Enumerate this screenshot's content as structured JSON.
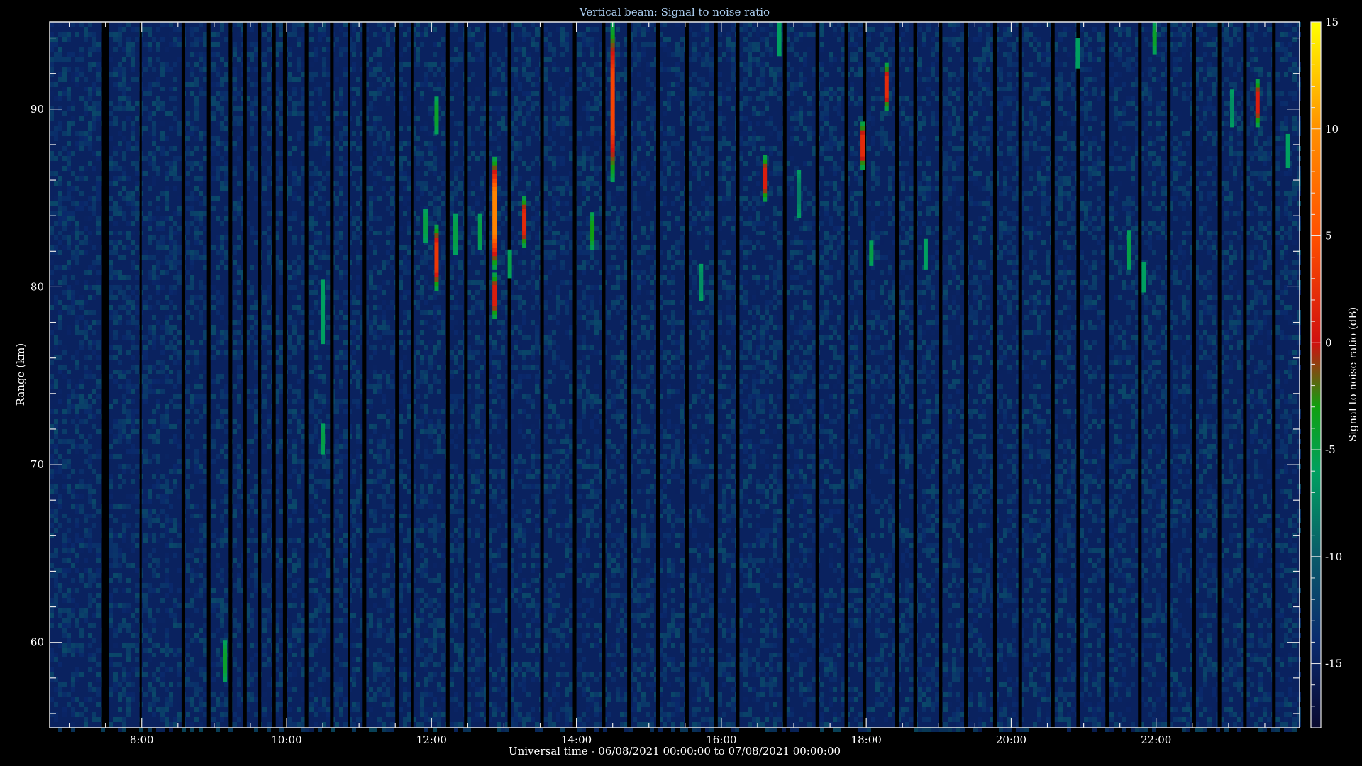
{
  "chart_data": {
    "type": "heatmap",
    "title": "Vertical beam: Signal to noise ratio",
    "xlabel": "Universal time - 06/08/2021 00:00:00 to 07/08/2021 00:00:00",
    "ylabel": "Range (km)",
    "colorbar_label": "Signal to noise ratio (dB)",
    "x_unit": "hours UT",
    "xlim": [
      6.73,
      23.98
    ],
    "ylim": [
      55.2,
      94.9
    ],
    "clim": [
      -18.0,
      15.0
    ],
    "x_ticks": [
      {
        "value": 8,
        "label": "8:00"
      },
      {
        "value": 10,
        "label": "10:00"
      },
      {
        "value": 12,
        "label": "12:00"
      },
      {
        "value": 14,
        "label": "14:00"
      },
      {
        "value": 16,
        "label": "16:00"
      },
      {
        "value": 18,
        "label": "18:00"
      },
      {
        "value": 20,
        "label": "20:00"
      },
      {
        "value": 22,
        "label": "22:00"
      }
    ],
    "y_ticks": [
      {
        "value": 60,
        "label": "60"
      },
      {
        "value": 70,
        "label": "70"
      },
      {
        "value": 80,
        "label": "80"
      },
      {
        "value": 90,
        "label": "90"
      }
    ],
    "colorbar_ticks": [
      {
        "value": 15,
        "label": "15"
      },
      {
        "value": 10,
        "label": "10"
      },
      {
        "value": 5,
        "label": "5"
      },
      {
        "value": 0,
        "label": "0"
      },
      {
        "value": -5,
        "label": "-5"
      },
      {
        "value": -10,
        "label": "-10"
      },
      {
        "value": -15,
        "label": "-15"
      }
    ],
    "colormap": [
      {
        "v": -18,
        "c": "#0a0a30"
      },
      {
        "v": -14,
        "c": "#0a2a6e"
      },
      {
        "v": -10,
        "c": "#0a5a6a"
      },
      {
        "v": -6,
        "c": "#00a060"
      },
      {
        "v": -3,
        "c": "#10a010"
      },
      {
        "v": 0,
        "c": "#d01010"
      },
      {
        "v": 5,
        "c": "#ff5000"
      },
      {
        "v": 10,
        "c": "#ff9000"
      },
      {
        "v": 15,
        "c": "#ffff00"
      }
    ],
    "background_level": -15,
    "data_gaps": [
      {
        "start": 7.45,
        "end": 7.55
      },
      {
        "start": 7.97,
        "end": 8.0
      },
      {
        "start": 8.55,
        "end": 8.6
      },
      {
        "start": 8.9,
        "end": 8.95
      },
      {
        "start": 9.2,
        "end": 9.25
      },
      {
        "start": 9.4,
        "end": 9.45
      },
      {
        "start": 9.6,
        "end": 9.65
      },
      {
        "start": 9.8,
        "end": 9.85
      },
      {
        "start": 9.95,
        "end": 10.0
      },
      {
        "start": 10.25,
        "end": 10.3
      },
      {
        "start": 10.6,
        "end": 10.65
      },
      {
        "start": 10.85,
        "end": 10.88
      },
      {
        "start": 11.05,
        "end": 11.1
      },
      {
        "start": 11.5,
        "end": 11.55
      },
      {
        "start": 11.72,
        "end": 11.75
      },
      {
        "start": 12.2,
        "end": 12.25
      },
      {
        "start": 12.45,
        "end": 12.5
      },
      {
        "start": 12.75,
        "end": 12.8
      },
      {
        "start": 13.05,
        "end": 13.1
      },
      {
        "start": 13.5,
        "end": 13.55
      },
      {
        "start": 13.95,
        "end": 14.0
      },
      {
        "start": 14.35,
        "end": 14.4
      },
      {
        "start": 14.7,
        "end": 14.75
      },
      {
        "start": 15.1,
        "end": 15.15
      },
      {
        "start": 15.5,
        "end": 15.55
      },
      {
        "start": 15.9,
        "end": 15.95
      },
      {
        "start": 16.2,
        "end": 16.25
      },
      {
        "start": 16.85,
        "end": 16.9
      },
      {
        "start": 17.3,
        "end": 17.35
      },
      {
        "start": 17.7,
        "end": 17.75
      },
      {
        "start": 17.95,
        "end": 18.0
      },
      {
        "start": 18.4,
        "end": 18.45
      },
      {
        "start": 18.65,
        "end": 18.7
      },
      {
        "start": 19.0,
        "end": 19.05
      },
      {
        "start": 19.35,
        "end": 19.4
      },
      {
        "start": 19.75,
        "end": 19.8
      },
      {
        "start": 20.1,
        "end": 20.15
      },
      {
        "start": 20.55,
        "end": 20.6
      },
      {
        "start": 20.9,
        "end": 20.95
      },
      {
        "start": 21.3,
        "end": 21.35
      },
      {
        "start": 21.75,
        "end": 21.8
      },
      {
        "start": 22.15,
        "end": 22.2
      },
      {
        "start": 22.5,
        "end": 22.55
      },
      {
        "start": 22.85,
        "end": 22.9
      },
      {
        "start": 23.2,
        "end": 23.25
      },
      {
        "start": 23.6,
        "end": 23.65
      }
    ],
    "echoes": [
      {
        "t": 9.15,
        "r0": 57.8,
        "r1": 60.1,
        "snr": -4
      },
      {
        "t": 10.5,
        "r0": 76.8,
        "r1": 80.4,
        "snr": -6
      },
      {
        "t": 10.5,
        "r0": 70.6,
        "r1": 72.3,
        "snr": -5
      },
      {
        "t": 11.92,
        "r0": 82.5,
        "r1": 84.4,
        "snr": -5
      },
      {
        "t": 12.07,
        "r0": 79.8,
        "r1": 83.5,
        "snr": 3
      },
      {
        "t": 12.07,
        "r0": 88.6,
        "r1": 90.7,
        "snr": -4
      },
      {
        "t": 12.33,
        "r0": 81.8,
        "r1": 84.1,
        "snr": -5
      },
      {
        "t": 12.67,
        "r0": 82.1,
        "r1": 84.1,
        "snr": -5
      },
      {
        "t": 12.87,
        "r0": 81.0,
        "r1": 87.3,
        "snr": 9
      },
      {
        "t": 12.87,
        "r0": 78.2,
        "r1": 80.8,
        "snr": 1
      },
      {
        "t": 13.08,
        "r0": 80.5,
        "r1": 82.1,
        "snr": -5
      },
      {
        "t": 13.28,
        "r0": 82.2,
        "r1": 85.1,
        "snr": 2
      },
      {
        "t": 14.22,
        "r0": 82.1,
        "r1": 84.2,
        "snr": -3
      },
      {
        "t": 14.5,
        "r0": 85.9,
        "r1": 94.9,
        "snr": 4
      },
      {
        "t": 15.72,
        "r0": 79.2,
        "r1": 81.3,
        "snr": -7
      },
      {
        "t": 16.6,
        "r0": 84.8,
        "r1": 87.4,
        "snr": 1
      },
      {
        "t": 16.8,
        "r0": 93.0,
        "r1": 94.9,
        "snr": -6
      },
      {
        "t": 17.07,
        "r0": 83.9,
        "r1": 86.6,
        "snr": -8
      },
      {
        "t": 17.95,
        "r0": 86.6,
        "r1": 89.3,
        "snr": 2
      },
      {
        "t": 18.07,
        "r0": 81.2,
        "r1": 82.6,
        "snr": -5
      },
      {
        "t": 18.28,
        "r0": 89.9,
        "r1": 92.6,
        "snr": 2
      },
      {
        "t": 18.82,
        "r0": 81.0,
        "r1": 82.7,
        "snr": -6
      },
      {
        "t": 20.92,
        "r0": 92.3,
        "r1": 94.0,
        "snr": -6
      },
      {
        "t": 21.63,
        "r0": 81.0,
        "r1": 83.2,
        "snr": -5
      },
      {
        "t": 21.83,
        "r0": 79.7,
        "r1": 81.4,
        "snr": -6
      },
      {
        "t": 21.98,
        "r0": 93.1,
        "r1": 94.9,
        "snr": -4
      },
      {
        "t": 23.05,
        "r0": 89.0,
        "r1": 91.1,
        "snr": -7
      },
      {
        "t": 23.4,
        "r0": 89.0,
        "r1": 91.7,
        "snr": 1
      },
      {
        "t": 23.82,
        "r0": 86.7,
        "r1": 88.6,
        "snr": -6
      }
    ]
  }
}
